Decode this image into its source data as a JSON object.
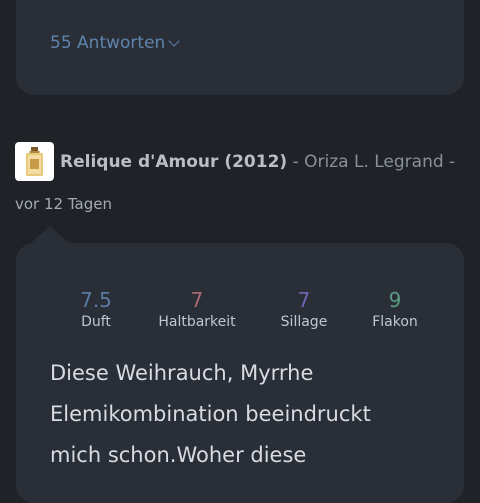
{
  "previous_card": {
    "answers_label": "55 Antworten"
  },
  "review": {
    "perfume_name": "Relique d'Amour (2012)",
    "separator1": " - ",
    "brand": "Oriza L. Legrand",
    "separator2": " -",
    "date": "vor 12 Tagen",
    "ratings": [
      {
        "value": "7.5",
        "label": "Duft",
        "color": "#5a7aa6"
      },
      {
        "value": "7",
        "label": "Haltbarkeit",
        "color": "#a86a73"
      },
      {
        "value": "7",
        "label": "Sillage",
        "color": "#6f64b0"
      },
      {
        "value": "9",
        "label": "Flakon",
        "color": "#5a9a84"
      }
    ],
    "text_lines": [
      "Diese Weihrauch, Myrrhe",
      "Elemikombination beeindruckt",
      "mich schon.Woher diese"
    ]
  },
  "colors": {
    "background": "#1f2328",
    "card": "#2a2e36",
    "link": "#5f84ad"
  }
}
